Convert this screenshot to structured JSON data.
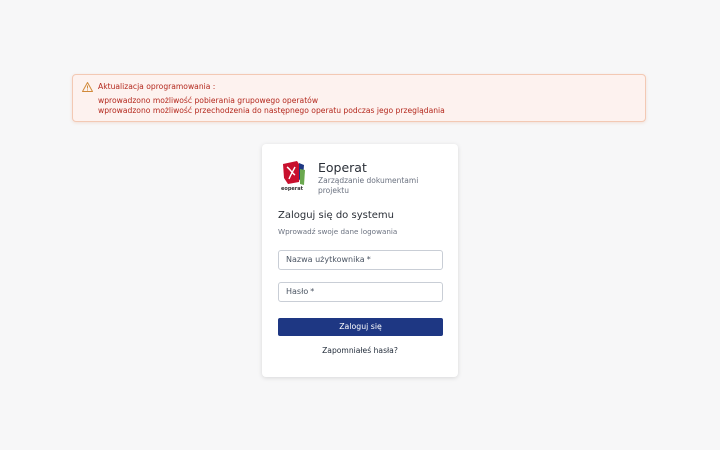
{
  "alert": {
    "title": "Aktualizacja oprogramowania :",
    "lines": [
      "wprowadzono możliwość pobierania grupowego operatów",
      "wprowadzono możliwość przechodzenia do następnego operatu podczas jego przeglądania"
    ],
    "icon": "warning-icon",
    "color": "#b4281d"
  },
  "app": {
    "logo_text": "eoperat",
    "name": "Eoperat",
    "subtitle": "Zarządzanie dokumentami projektu"
  },
  "login": {
    "title": "Zaloguj się do systemu",
    "subtitle": "Wprowadź swoje dane logowania",
    "username_label": "Nazwa użytkownika",
    "password_label": "Hasło",
    "required_mark": "*",
    "submit_label": "Zaloguj się",
    "forgot_label": "Zapomniałeś hasła?",
    "accent_color": "#1e3783"
  }
}
